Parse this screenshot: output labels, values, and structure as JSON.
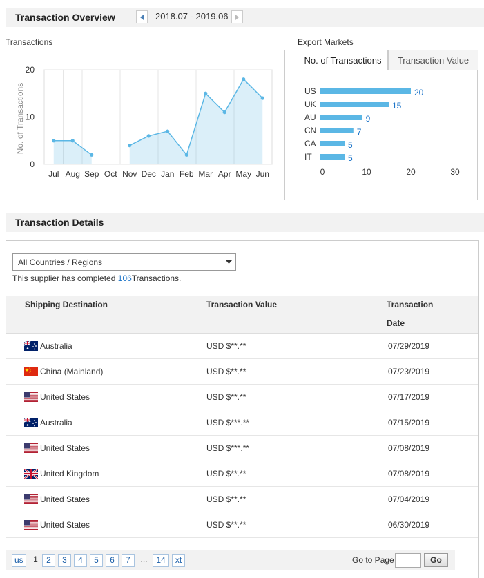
{
  "overview": {
    "title": "Transaction Overview",
    "period": "2018.07 - 2019.06"
  },
  "transactions_label": "Transactions",
  "export_markets_label": "Export Markets",
  "tabs": [
    {
      "label": "No. of Transactions",
      "active": true
    },
    {
      "label": "Transaction Value",
      "active": false
    }
  ],
  "chart_data": [
    {
      "type": "area",
      "ylabel": "No. of Transactions",
      "xlabel": "",
      "categories": [
        "Jul",
        "Aug",
        "Sep",
        "Oct",
        "Nov",
        "Dec",
        "Jan",
        "Feb",
        "Mar",
        "Apr",
        "May",
        "Jun"
      ],
      "values": [
        5,
        5,
        2,
        null,
        4,
        6,
        7,
        2,
        15,
        11,
        18,
        14
      ],
      "ylim": [
        0,
        20
      ],
      "yticks": [
        "0",
        "10",
        "20"
      ],
      "grid": true,
      "color": "#5bb7e5"
    },
    {
      "type": "bar",
      "orientation": "horizontal",
      "categories": [
        "US",
        "UK",
        "AU",
        "CN",
        "CA",
        "IT"
      ],
      "values": [
        20,
        15,
        9,
        7,
        5,
        5
      ],
      "labels": [
        "20",
        "15",
        "9",
        "7",
        "5",
        "5"
      ],
      "xlim": [
        0,
        30
      ],
      "xticks": [
        "0",
        "10",
        "20",
        "30"
      ],
      "color": "#5bb7e5"
    }
  ],
  "details": {
    "title": "Transaction Details",
    "filter_value": "All Countries / Regions",
    "summary_prefix": "This supplier has completed",
    "summary_count": "106",
    "summary_suffix": "Transactions.",
    "columns": {
      "destination": "Shipping Destination",
      "value": "Transaction Value",
      "date_line1": "Transaction",
      "date_line2": "Date"
    },
    "rows": [
      {
        "flag": "australia-flag-icon",
        "country": "Australia",
        "value": "USD $**.**",
        "date": "07/29/2019"
      },
      {
        "flag": "china-flag-icon",
        "country": "China (Mainland)",
        "value": "USD $**.**",
        "date": "07/23/2019"
      },
      {
        "flag": "us-flag-icon",
        "country": "United States",
        "value": "USD $**.**",
        "date": "07/17/2019"
      },
      {
        "flag": "australia-flag-icon",
        "country": "Australia",
        "value": "USD $***.**",
        "date": "07/15/2019"
      },
      {
        "flag": "us-flag-icon",
        "country": "United States",
        "value": "USD $***.**",
        "date": "07/08/2019"
      },
      {
        "flag": "uk-flag-icon",
        "country": "United Kingdom",
        "value": "USD $**.**",
        "date": "07/08/2019"
      },
      {
        "flag": "us-flag-icon",
        "country": "United States",
        "value": "USD $**.**",
        "date": "07/04/2019"
      },
      {
        "flag": "us-flag-icon",
        "country": "United States",
        "value": "USD $**.**",
        "date": "06/30/2019"
      }
    ]
  },
  "pager": {
    "prev": "us",
    "pages": [
      "1",
      "2",
      "3",
      "4",
      "5",
      "6",
      "7"
    ],
    "current": "1",
    "dots": "...",
    "last": "14",
    "next": "xt",
    "goto_label": "Go to Page",
    "go": "Go"
  }
}
